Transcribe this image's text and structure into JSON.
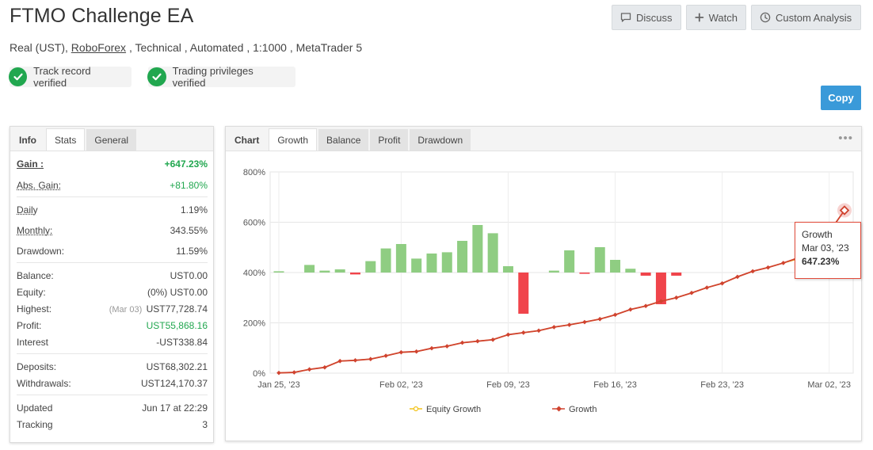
{
  "header": {
    "title": "FTMO Challenge EA",
    "account_type": "Real (UST), ",
    "broker": "RoboForex",
    "details": " , Technical , Automated , 1:1000 , MetaTrader 5"
  },
  "verifications": [
    {
      "label": "Track record verified"
    },
    {
      "label": "Trading privileges verified"
    }
  ],
  "actions": {
    "discuss": "Discuss",
    "watch": "Watch",
    "custom_analysis": "Custom Analysis",
    "copy": "Copy"
  },
  "stats_panel": {
    "tabs": [
      "Info",
      "Stats",
      "General"
    ],
    "gain_label": "Gain :",
    "gain_value": "+647.23%",
    "abs_gain_label": "Abs. Gain:",
    "abs_gain_value": "+81.80%",
    "daily_label": "Daily",
    "daily_value": "1.19%",
    "monthly_label": "Monthly:",
    "monthly_value": "343.55%",
    "drawdown_label": "Drawdown:",
    "drawdown_value": "11.59%",
    "balance_label": "Balance:",
    "balance_value": "UST0.00",
    "equity_label": "Equity:",
    "equity_value": "(0%) UST0.00",
    "highest_label": "Highest:",
    "highest_date": "(Mar 03)",
    "highest_value": "UST77,728.74",
    "profit_label": "Profit:",
    "profit_value": "UST55,868.16",
    "interest_label": "Interest",
    "interest_value": "-UST338.84",
    "deposits_label": "Deposits:",
    "deposits_value": "UST68,302.21",
    "withdrawals_label": "Withdrawals:",
    "withdrawals_value": "UST124,170.37",
    "updated_label": "Updated",
    "updated_value": "Jun 17 at 22:29",
    "tracking_label": "Tracking",
    "tracking_value": "3"
  },
  "chart_panel": {
    "tabs": [
      "Chart",
      "Growth",
      "Balance",
      "Profit",
      "Drawdown"
    ],
    "more_icon": "ellipsis-icon",
    "tooltip": {
      "series": "Growth",
      "date": "Mar 03, '23",
      "value": "647.23%"
    }
  },
  "chart_data": {
    "type": "line",
    "ylim": [
      0,
      800
    ],
    "y_ticks": [
      "0%",
      "200%",
      "400%",
      "600%",
      "800%"
    ],
    "x_ticks": [
      "Jan 25, '23",
      "Feb 02, '23",
      "Feb 09, '23",
      "Feb 16, '23",
      "Feb 23, '23",
      "Mar 02, '23"
    ],
    "legend": [
      "Equity Growth",
      "Growth"
    ],
    "colors": {
      "growth": "#d0432f",
      "equity": "#f2c31a",
      "bar_pos": "#8fcd82",
      "bar_neg": "#f0444b"
    },
    "x": [
      "Jan 25",
      "Jan 26",
      "Jan 27",
      "Jan 28",
      "Jan 29",
      "Jan 30",
      "Jan 31",
      "Feb 01",
      "Feb 02",
      "Feb 03",
      "Feb 04",
      "Feb 05",
      "Feb 06",
      "Feb 07",
      "Feb 08",
      "Feb 09",
      "Feb 10",
      "Feb 11",
      "Feb 12",
      "Feb 13",
      "Feb 14",
      "Feb 15",
      "Feb 16",
      "Feb 17",
      "Feb 18",
      "Feb 19",
      "Feb 20",
      "Feb 21",
      "Feb 22",
      "Feb 23",
      "Feb 24",
      "Feb 25",
      "Feb 26",
      "Feb 27",
      "Feb 28",
      "Mar 01",
      "Mar 02",
      "Mar 03"
    ],
    "series": [
      {
        "name": "Growth",
        "values": [
          1,
          3,
          15,
          23,
          48,
          51,
          56,
          69,
          83,
          86,
          99,
          107,
          121,
          127,
          133,
          153,
          161,
          169,
          183,
          192,
          203,
          215,
          232,
          253,
          267,
          286,
          300,
          319,
          340,
          357,
          383,
          405,
          420,
          438,
          459,
          498,
          561,
          647.23
        ]
      },
      {
        "name": "Equity Growth",
        "values": [
          1,
          3,
          15,
          23,
          48,
          51,
          56,
          69,
          83,
          86,
          99,
          107,
          121,
          127,
          133,
          153,
          161,
          169,
          183,
          192,
          203,
          215,
          232,
          253,
          267,
          286,
          300,
          319,
          340,
          357,
          383,
          405,
          420,
          438,
          455,
          470,
          561,
          647.23
        ]
      }
    ],
    "bars": [
      {
        "x": "Jan 25",
        "value": 2
      },
      {
        "x": "Jan 27",
        "value": 12
      },
      {
        "x": "Jan 28",
        "value": 3
      },
      {
        "x": "Jan 29",
        "value": 5
      },
      {
        "x": "Jan 30",
        "value": -3
      },
      {
        "x": "Jan 31",
        "value": 18
      },
      {
        "x": "Feb 01",
        "value": 38
      },
      {
        "x": "Feb 02",
        "value": 45
      },
      {
        "x": "Feb 03",
        "value": 22
      },
      {
        "x": "Feb 04",
        "value": 30
      },
      {
        "x": "Feb 05",
        "value": 32
      },
      {
        "x": "Feb 06",
        "value": 50
      },
      {
        "x": "Feb 07",
        "value": 75
      },
      {
        "x": "Feb 08",
        "value": 62
      },
      {
        "x": "Feb 09",
        "value": 10
      },
      {
        "x": "Feb 10",
        "value": -65
      },
      {
        "x": "Feb 12",
        "value": 3
      },
      {
        "x": "Feb 13",
        "value": 35
      },
      {
        "x": "Feb 14",
        "value": -2
      },
      {
        "x": "Feb 15",
        "value": 40
      },
      {
        "x": "Feb 16",
        "value": 20
      },
      {
        "x": "Feb 17",
        "value": 6
      },
      {
        "x": "Feb 18",
        "value": -5
      },
      {
        "x": "Feb 19",
        "value": -50
      },
      {
        "x": "Feb 20",
        "value": -5
      }
    ]
  }
}
